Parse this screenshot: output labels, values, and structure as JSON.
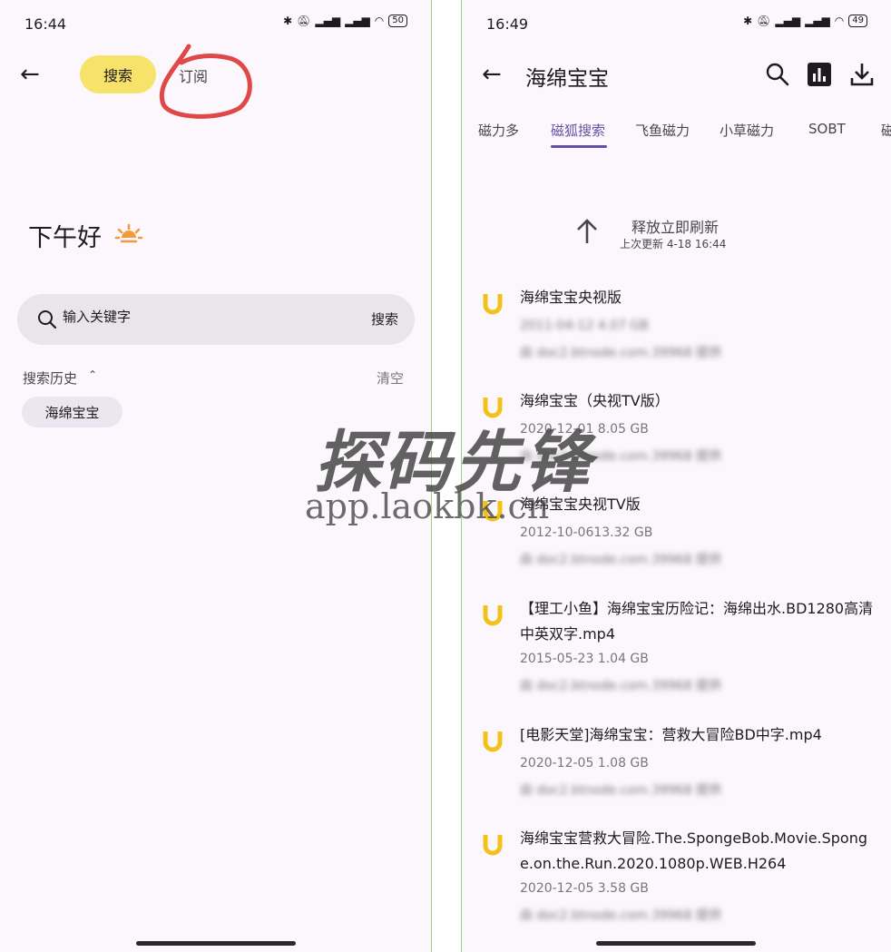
{
  "left": {
    "status": {
      "time": "16:44",
      "battery": "50"
    },
    "tabs": {
      "search": "搜索",
      "subscribe": "订阅"
    },
    "greeting": "下午好",
    "search": {
      "placeholder": "输入关键字",
      "button": "搜索"
    },
    "history": {
      "label": "搜索历史",
      "clear": "清空",
      "chips": [
        "海绵宝宝"
      ]
    }
  },
  "right": {
    "status": {
      "time": "16:49",
      "battery": "49"
    },
    "title": "海绵宝宝",
    "tabs": [
      "磁力多",
      "磁狐搜索",
      "飞鱼磁力",
      "小草磁力",
      "SOBT",
      "磁"
    ],
    "active_tab": "磁狐搜索",
    "refresh": {
      "label": "释放立即刷新",
      "updated": "上次更新 4-18 16:44"
    },
    "results": [
      {
        "name": "海绵宝宝央视版",
        "meta": "2011-04-12 4.07 GB",
        "source": "由 doc2.btnode.com.39968 提供"
      },
      {
        "name": "海绵宝宝（央视TV版）",
        "meta": "2020-12-01 8.05 GB",
        "source": "由 doc2.btnode.com.39968 提供"
      },
      {
        "name": "海绵宝宝央视TV版",
        "meta": "2012-10-0613.32 GB",
        "source": "由 doc2.btnode.com.39968 提供"
      },
      {
        "name": "【理工小鱼】海绵宝宝历险记：海绵出水.BD1280高清中英双字.mp4",
        "meta": "2015-05-23  1.04 GB",
        "source": "由 doc2.btnode.com.39968 提供"
      },
      {
        "name": "[电影天堂]海绵宝宝：营救大冒险BD中字.mp4",
        "meta": "2020-12-05  1.08 GB",
        "source": "由 doc2.btnode.com.39968 提供"
      },
      {
        "name": "海绵宝宝营救大冒险.The.SpongeBob.Movie.Sponge.on.the.Run.2020.1080p.WEB.H264",
        "meta": "2020-12-05  3.58 GB",
        "source": "由 doc2.btnode.com.39968 提供"
      }
    ]
  },
  "watermark": {
    "title": "探码先锋",
    "url": "app.laokbk.cn"
  },
  "colors": {
    "accent_yellow": "#f8e36a",
    "tab_active": "#6750a4",
    "result_icon": "#f2c21b",
    "annotation_red": "#e04848"
  }
}
